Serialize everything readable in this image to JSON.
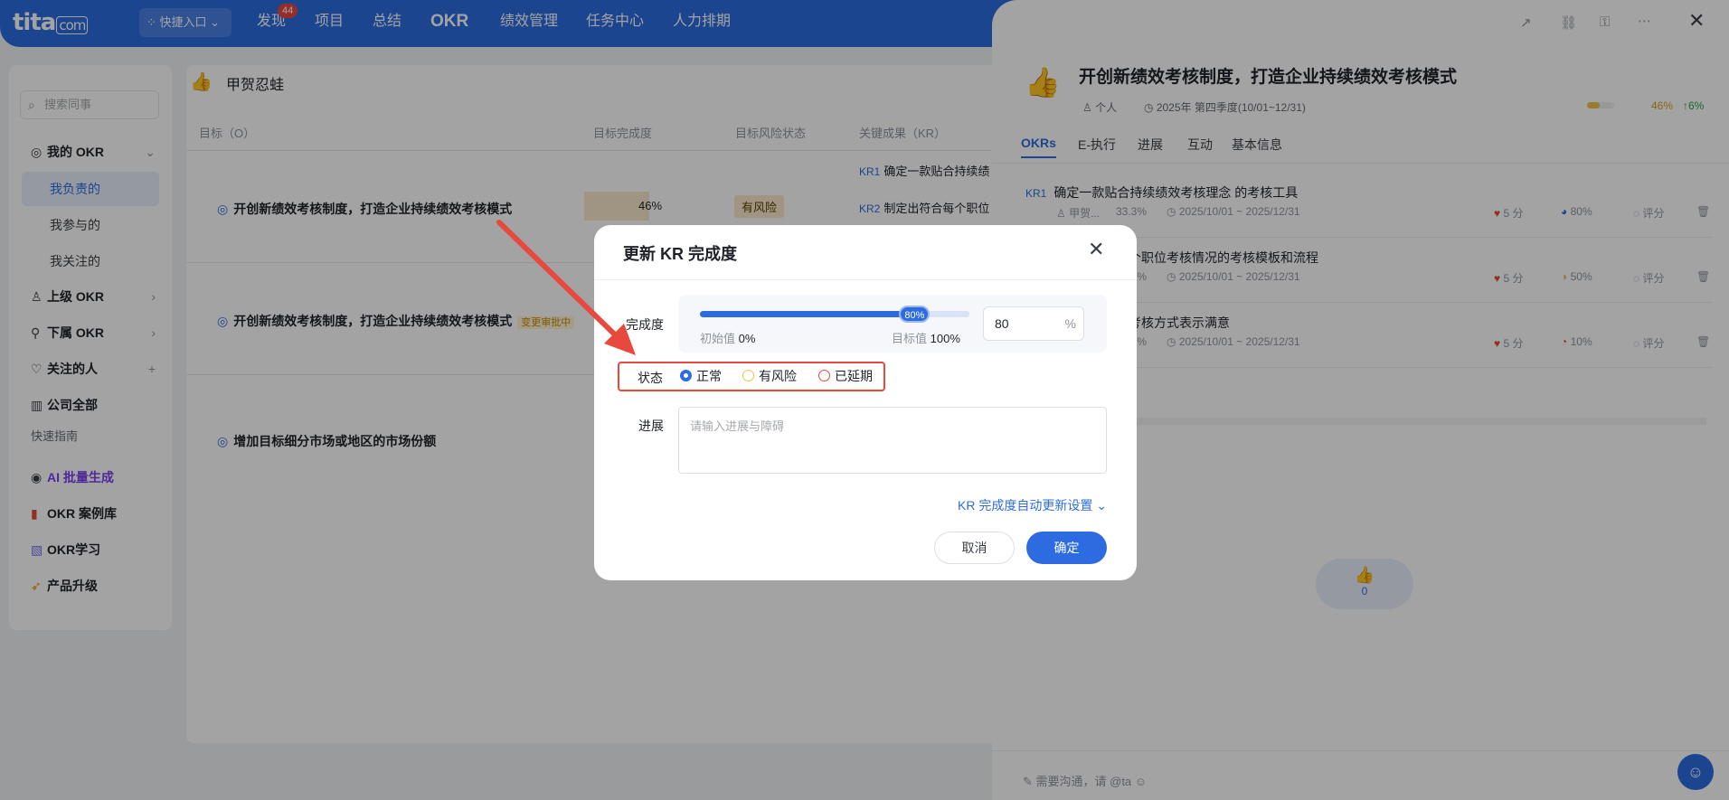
{
  "app": {
    "logo": "tita",
    "logo_suffix": "com",
    "quick_entry": "快捷入口",
    "nav": [
      "发现",
      "项目",
      "总结",
      "OKR",
      "绩效管理",
      "任务中心",
      "人力排期"
    ],
    "discover_badge": "44"
  },
  "sidebar": {
    "search_placeholder": "搜索同事",
    "my_okr": "我的 OKR",
    "sub_items": [
      "我负责的",
      "我参与的",
      "我关注的"
    ],
    "upper_okr": "上级 OKR",
    "lower_okr": "下属 OKR",
    "followed": "关注的人",
    "company": "公司全部",
    "guide": "快速指南",
    "ai_gen": "AI 批量生成",
    "cases": "OKR 案例库",
    "learn": "OKR学习",
    "upgrade": "产品升级"
  },
  "main": {
    "user": "甲贺忍蛙",
    "columns": [
      "目标（O）",
      "目标完成度",
      "目标风险状态",
      "关键成果（KR）"
    ],
    "rows": [
      {
        "title": "开创新绩效考核制度，打造企业持续绩效考核模式",
        "progress": "46%",
        "risk": "有风险",
        "kr1_key": "KR1",
        "kr1": "确定一款贴合持续绩",
        "kr2_key": "KR2",
        "kr2": "制定出符合每个职位"
      },
      {
        "title": "开创新绩效考核制度，打造企业持续绩效考核模式",
        "tag": "变更审批中"
      },
      {
        "title": "增加目标细分市场或地区的市场份额"
      }
    ]
  },
  "panel": {
    "title": "开创新绩效考核制度，打造企业持续绩效考核模式",
    "owner": "个人",
    "period": "2025年 第四季度(10/01~12/31)",
    "progress": "46%",
    "delta": "↑6%",
    "tabs": [
      "OKRs",
      "E-执行",
      "进展",
      "互动",
      "基本信息"
    ],
    "krs": [
      {
        "key": "KR1",
        "title": "确定一款贴合持续绩效考核理念 的考核工具",
        "owner": "甲贺...",
        "weight": "33.3%",
        "range": "2025/10/01 ~ 2025/12/31",
        "score": "5 分",
        "pct": "80%",
        "rate": "评分"
      },
      {
        "title": "个职位考核情况的考核模板和流程",
        "weight": "33.3%",
        "range": "2025/10/01 ~ 2025/12/31",
        "score": "5 分",
        "pct": "50%",
        "rate": "评分"
      },
      {
        "title": "考核方式表示满意",
        "weight": "33.3%",
        "range": "2025/10/01 ~ 2025/12/31",
        "score": "5 分",
        "pct": "10%",
        "rate": "评分"
      }
    ],
    "like_count": "0",
    "comment_placeholder": "需要沟通，请 @ta"
  },
  "modal": {
    "title": "更新 KR 完成度",
    "progress_label": "完成度",
    "progress_value": 80,
    "knob_text": "80%",
    "initial_label": "初始值",
    "initial_value": "0%",
    "target_label": "目标值",
    "target_value": "100%",
    "input_value": "80",
    "unit": "%",
    "status_label": "状态",
    "status_options": [
      "正常",
      "有风险",
      "已延期"
    ],
    "status_selected": "正常",
    "progress_note_label": "进展",
    "progress_note_placeholder": "请输入进展与障碍",
    "auto_update": "KR 完成度自动更新设置",
    "cancel": "取消",
    "confirm": "确定"
  },
  "colors": {
    "primary": "#2d6ce0",
    "risk": "#f0c04a",
    "delay": "#e8493e",
    "highlight": "#e8493e"
  }
}
